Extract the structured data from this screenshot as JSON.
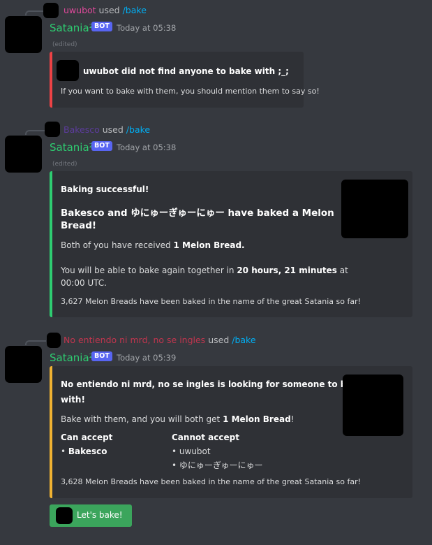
{
  "messages": [
    {
      "reply": {
        "user": "uwubot",
        "user_color": "#e0499b",
        "used": "used",
        "command": "/bake"
      },
      "author": "Satania²",
      "bot_tag": "BOT",
      "timestamp": "Today at 05:38",
      "edited": "(edited)",
      "embed": {
        "accent": "#ed4245",
        "author_line": "uwubot did not find anyone to bake with ;_;",
        "description": "If you want to bake with them, you should mention them to say so!"
      }
    },
    {
      "reply": {
        "user": "Bakesco",
        "user_color": "#5c3c9c",
        "used": "used",
        "command": "/bake"
      },
      "author": "Satania²",
      "bot_tag": "BOT",
      "timestamp": "Today at 05:38",
      "edited": "(edited)",
      "embed": {
        "accent": "#2ecc71",
        "heading": "Baking successful!",
        "title_line1": "Bakesco and ゆにゅーぎゅーにゅー have baked a Melon",
        "title_line2": "Bread!",
        "received_pre": "Both of you have received ",
        "received_bold": "1 Melon Bread.",
        "again_pre": "You will be able to bake again together in ",
        "again_bold": "20 hours, 21 minutes",
        "again_post": " at",
        "again_line2": "00:00 UTC.",
        "footer": "3,627 Melon Breads have been baked in the name of the great Satania so far!"
      }
    },
    {
      "reply": {
        "user": "No entiendo ni mrd, no se ingles",
        "user_color": "#c0354e",
        "used": "used",
        "command": "/bake"
      },
      "author": "Satania²",
      "bot_tag": "BOT",
      "timestamp": "Today at 05:39",
      "embed": {
        "accent": "#f0b232",
        "title_line1": "No entiendo ni mrd, no se ingles is looking for someone to bake",
        "title_line2": "with!",
        "desc_pre": "Bake with them, and you will both get ",
        "desc_bold": "1 Melon Bread",
        "desc_post": "!",
        "can_accept_label": "Can accept",
        "can_accept": [
          "Bakesco"
        ],
        "cannot_accept_label": "Cannot accept",
        "cannot_accept": [
          "uwubot",
          "ゆにゅーぎゅーにゅー"
        ],
        "footer": "3,628 Melon Breads have been baked in the name of the great Satania so far!"
      },
      "button": {
        "label": "Let's bake!",
        "color": "#3ba55c"
      }
    }
  ]
}
